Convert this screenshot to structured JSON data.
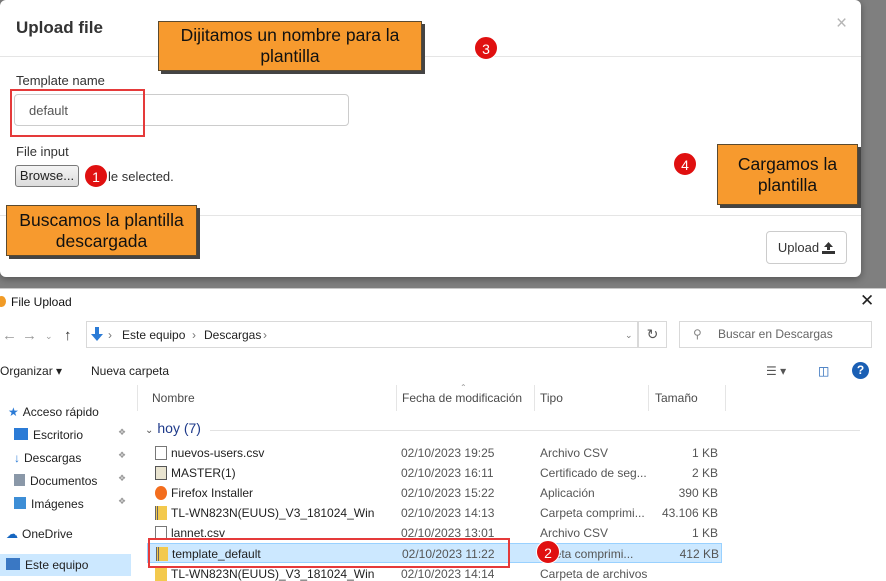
{
  "modal": {
    "title": "Upload file",
    "close": "×",
    "template_label": "Template name",
    "template_value": "default",
    "file_label": "File input",
    "browse_label": "Browse...",
    "file_status": "le selected.",
    "upload_label": "Upload"
  },
  "annotations": {
    "note_name": "Dijitamos un nombre para la plantilla",
    "note_search": "Buscamos la plantilla descargada",
    "note_load": "Cargamos la plantilla",
    "badges": [
      "1",
      "2",
      "3",
      "4"
    ]
  },
  "dialog": {
    "title": "File Upload",
    "close": "✕",
    "breadcrumb": [
      "Este equipo",
      "Descargas"
    ],
    "search_placeholder": "Buscar en Descargas",
    "toolbar": {
      "organize": "Organizar ▾",
      "new_folder": "Nueva carpeta"
    },
    "sidebar": [
      {
        "label": "Acceso rápido",
        "icon": "star-icon"
      },
      {
        "label": "Escritorio",
        "icon": "desktop-icon"
      },
      {
        "label": "Descargas",
        "icon": "download-icon"
      },
      {
        "label": "Documentos",
        "icon": "documents-icon"
      },
      {
        "label": "Imágenes",
        "icon": "pictures-icon"
      },
      {
        "label": "OneDrive",
        "icon": "cloud-icon"
      },
      {
        "label": "Este equipo",
        "icon": "computer-icon"
      }
    ],
    "columns": [
      "Nombre",
      "Fecha de modificación",
      "Tipo",
      "Tamaño"
    ],
    "group": "hoy (7)",
    "files": [
      {
        "name": "nuevos-users.csv",
        "date": "02/10/2023 19:25",
        "type": "Archivo CSV",
        "size": "1 KB",
        "icon": "csv-file-icon"
      },
      {
        "name": "MASTER(1)",
        "date": "02/10/2023 16:11",
        "type": "Certificado de seg...",
        "size": "2 KB",
        "icon": "certificate-icon"
      },
      {
        "name": "Firefox Installer",
        "date": "02/10/2023 15:22",
        "type": "Aplicación",
        "size": "390 KB",
        "icon": "firefox-icon"
      },
      {
        "name": "TL-WN823N(EUUS)_V3_181024_Win",
        "date": "02/10/2023 14:13",
        "type": "Carpeta comprimi...",
        "size": "43.106 KB",
        "icon": "zip-folder-icon"
      },
      {
        "name": "lannet.csv",
        "date": "02/10/2023 13:01",
        "type": "Archivo CSV",
        "size": "1 KB",
        "icon": "csv-file-icon"
      },
      {
        "name": "template_default",
        "date": "02/10/2023 11:22",
        "type": "rpeta comprimi...",
        "size": "412 KB",
        "icon": "zip-folder-icon"
      },
      {
        "name": "TL-WN823N(EUUS)_V3_181024_Win",
        "date": "02/10/2023 14:14",
        "type": "Carpeta de archivos",
        "size": "",
        "icon": "folder-icon"
      }
    ]
  },
  "colors": {
    "note_bg": "#f79a2e",
    "badge": "#e01010",
    "highlight": "#e53a3a",
    "selection": "#cce8ff"
  }
}
